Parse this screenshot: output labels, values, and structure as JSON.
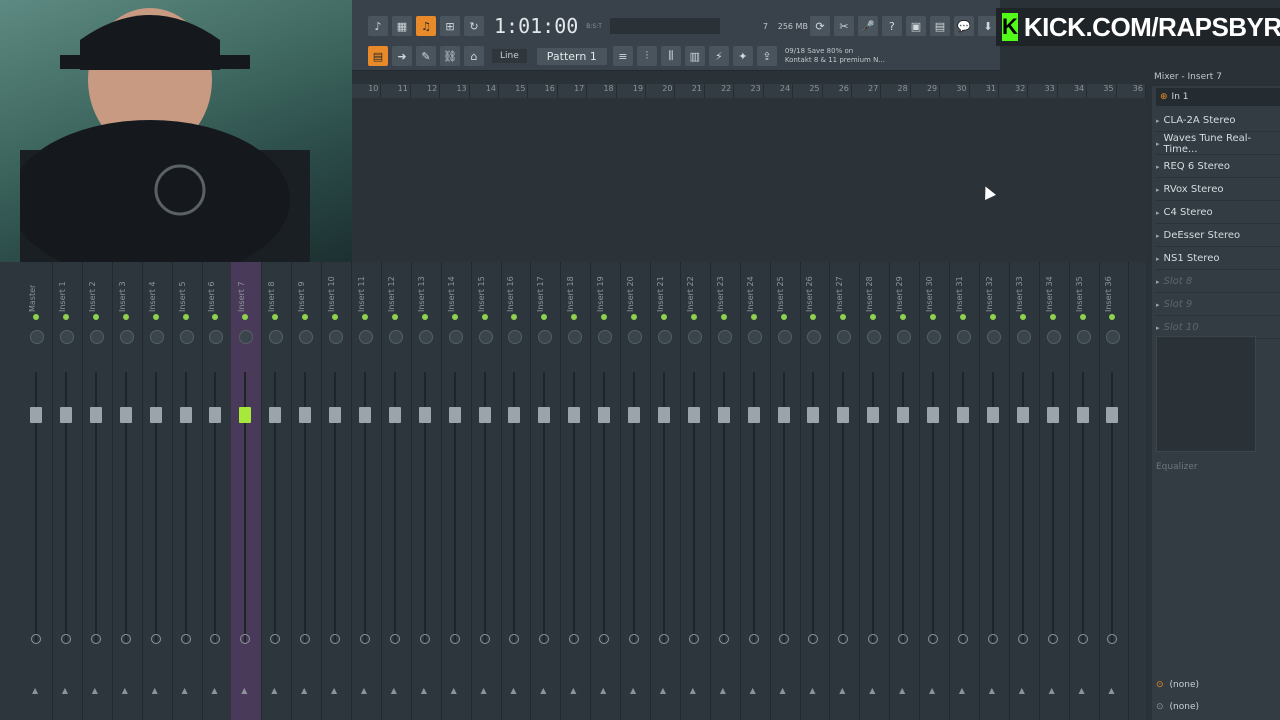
{
  "transport": {
    "time": "1:01:00",
    "time_suffix": "B:S:T",
    "memory": "256 MB",
    "cpu_count": "7",
    "polyphony": "0"
  },
  "toolbar": {
    "line_mode": "Line",
    "pattern": "Pattern 1",
    "hint_counter": "09/18",
    "hint_line1": "Save 80% on",
    "hint_line2": "Kontakt 8 & 11 premium N..."
  },
  "overlay": {
    "kick_text": "KICK.COM/RAPSBYRC"
  },
  "playlist": {
    "bars": [
      "10",
      "11",
      "12",
      "13",
      "14",
      "15",
      "16",
      "17",
      "18",
      "19",
      "20",
      "21",
      "22",
      "23",
      "24",
      "25",
      "26",
      "27",
      "28",
      "29",
      "30",
      "31",
      "32",
      "33",
      "34",
      "35",
      "36"
    ]
  },
  "mixer": {
    "strips": [
      "Master",
      "Insert 1",
      "Insert 2",
      "Insert 3",
      "Insert 4",
      "Insert 5",
      "Insert 6",
      "Insert 7",
      "Insert 8",
      "Insert 9",
      "Insert 10",
      "Insert 11",
      "Insert 12",
      "Insert 13",
      "Insert 14",
      "Insert 15",
      "Insert 16",
      "Insert 17",
      "Insert 18",
      "Insert 19",
      "Insert 20",
      "Insert 21",
      "Insert 22",
      "Insert 23",
      "Insert 24",
      "Insert 25",
      "Insert 26",
      "Insert 27",
      "Insert 28",
      "Insert 29",
      "Insert 30",
      "Insert 31",
      "Insert 32",
      "Insert 33",
      "Insert 34",
      "Insert 35",
      "Insert 36"
    ],
    "selected_index": 7
  },
  "panel": {
    "title": "Mixer - Insert 7",
    "input": "In 1",
    "slots": [
      {
        "label": "CLA-2A Stereo",
        "empty": false
      },
      {
        "label": "Waves Tune Real-Time...",
        "empty": false
      },
      {
        "label": "REQ 6 Stereo",
        "empty": false
      },
      {
        "label": "RVox Stereo",
        "empty": false
      },
      {
        "label": "C4 Stereo",
        "empty": false
      },
      {
        "label": "DeEsser Stereo",
        "empty": false
      },
      {
        "label": "NS1 Stereo",
        "empty": false
      },
      {
        "label": "Slot 8",
        "empty": true
      },
      {
        "label": "Slot 9",
        "empty": true
      },
      {
        "label": "Slot 10",
        "empty": true
      }
    ],
    "eq_label": "Equalizer",
    "output_1": "(none)",
    "output_2": "(none)"
  },
  "colors": {
    "accent": "#e98a2a",
    "selected_strip": "#4a3a5a",
    "fader_active": "#a8e83a",
    "led": "#8fd14f",
    "kick_green": "#53fc18"
  },
  "icons": [
    "play-icon",
    "record-icon",
    "metronome-icon",
    "save-icon",
    "help-icon",
    "microphone-icon",
    "download-icon",
    "chat-icon",
    "settings-icon",
    "piano-icon",
    "link-icon",
    "arrow-icon"
  ]
}
